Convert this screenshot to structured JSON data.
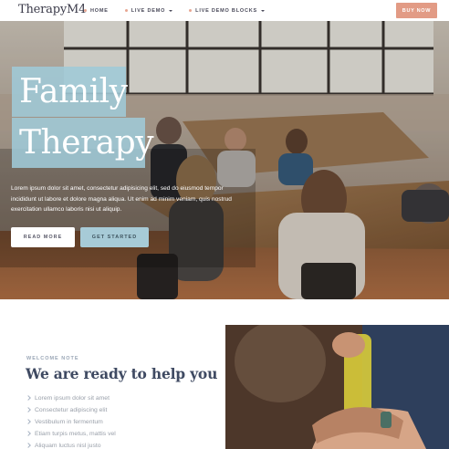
{
  "header": {
    "logo": "TherapyM4",
    "nav": [
      {
        "label": "HOME",
        "has_dropdown": false
      },
      {
        "label": "LIVE DEMO",
        "has_dropdown": true
      },
      {
        "label": "LIVE DEMO BLOCKS",
        "has_dropdown": true
      }
    ],
    "buy_label": "BUY NOW"
  },
  "hero": {
    "title_line1": "Family",
    "title_line2": "Therapy",
    "description": "Lorem ipsum dolor sit amet, consectetur adipisicing elit, sed do eiusmod tempor incididunt ut labore et dolore magna aliqua. Ut enim ad minim veniam, quis nostrud exercitation ullamco laboris nisi ut aliquip.",
    "read_more_label": "READ MORE",
    "get_started_label": "GET STARTED"
  },
  "welcome": {
    "eyebrow": "WELCOME NOTE",
    "title": "We are ready to help you",
    "items": [
      "Lorem ipsum dolor sit amet",
      "Consectetur adipiscing elit",
      "Vestibulum in fermentum",
      "Etiam turpis metus, mattis vel",
      "Aliquam luctus nisl justo"
    ]
  },
  "colors": {
    "accent": "#e29b85",
    "title_block": "#9fc9d7",
    "heading": "#3f4a62"
  }
}
